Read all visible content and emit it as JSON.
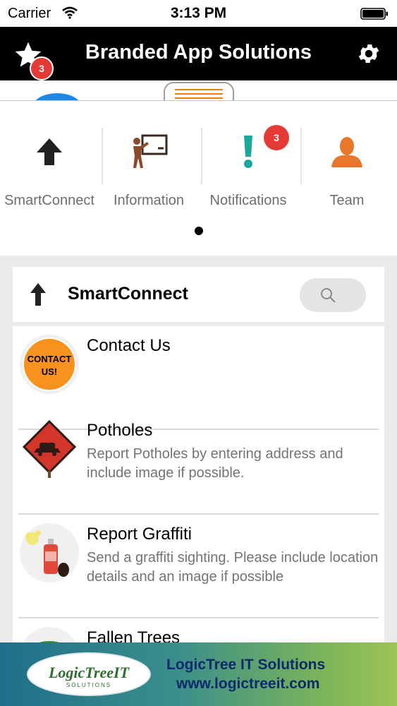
{
  "status_bar": {
    "carrier": "Carrier",
    "time": "3:13 PM"
  },
  "nav": {
    "title": "Branded App Solutions",
    "favorites_badge": "3"
  },
  "drawer": {
    "items": [
      {
        "label": "SmartConnect",
        "icon": "arrow-up-icon"
      },
      {
        "label": "Information",
        "icon": "presentation-icon"
      },
      {
        "label": "Notifications",
        "icon": "exclamation-icon",
        "badge": "3"
      },
      {
        "label": "Team",
        "icon": "person-icon"
      }
    ],
    "page_indicator": {
      "pages": 1,
      "current": 1
    }
  },
  "section": {
    "title": "SmartConnect"
  },
  "list": {
    "items": [
      {
        "title": "Contact Us",
        "description": "",
        "thumb": "contact-us-thumb",
        "thumb_text": "CONTACT US!"
      },
      {
        "title": "Potholes",
        "description": "Report Potholes by entering address and include image if possible.",
        "thumb": "pothole-sign-thumb"
      },
      {
        "title": "Report Graffiti",
        "description": "Send a graffiti sighting. Please include location details and an image if possible",
        "thumb": "spray-can-thumb"
      },
      {
        "title": "Fallen Trees",
        "description": "",
        "thumb": "tree-thumb"
      }
    ]
  },
  "ad": {
    "logo_text": "LogicTreeIT",
    "logo_sub": "SOLUTIONS",
    "line1": "LogicTree IT Solutions",
    "line2": "www.logictreeit.com"
  },
  "colors": {
    "nav_bg": "#000000",
    "badge": "#e53935",
    "notification_icon": "#1aa89a",
    "team_icon": "#e8762b",
    "contact_orange": "#f7921e"
  }
}
